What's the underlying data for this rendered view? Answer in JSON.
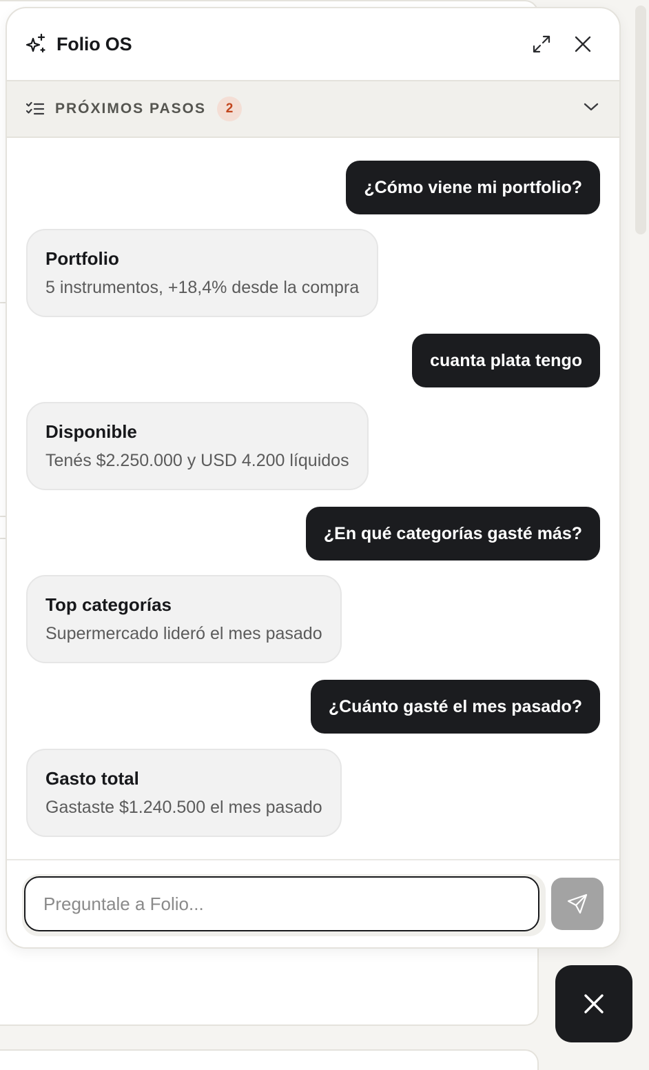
{
  "chat": {
    "title": "Folio OS",
    "header_icons": {
      "logo": "sparkle-icon",
      "expand": "expand-icon",
      "close": "close-icon"
    },
    "next_steps": {
      "label": "PRÓXIMOS PASOS",
      "count": "2",
      "icon": "checklist-icon",
      "toggle_icon": "chevron-down-icon"
    },
    "messages": [
      {
        "role": "user",
        "text": "¿Cómo viene mi portfolio?"
      },
      {
        "role": "assistant",
        "title": "Portfolio",
        "text": "5 instrumentos, +18,4% desde la compra"
      },
      {
        "role": "user",
        "text": "cuanta plata tengo"
      },
      {
        "role": "assistant",
        "title": "Disponible",
        "text": "Tenés $2.250.000 y USD 4.200 líquidos"
      },
      {
        "role": "user",
        "text": "¿En qué categorías gasté más?"
      },
      {
        "role": "assistant",
        "title": "Top categorías",
        "text": "Supermercado lideró el mes pasado"
      },
      {
        "role": "user",
        "text": "¿Cuánto gasté el mes pasado?"
      },
      {
        "role": "assistant",
        "title": "Gasto total",
        "text": "Gastaste $1.240.500 el mes pasado"
      }
    ],
    "input": {
      "placeholder": "Preguntale a Folio...",
      "value": ""
    },
    "send_icon": "send-icon"
  },
  "fab": {
    "icon": "close-icon"
  },
  "colors": {
    "bubble_user": "#1b1c1f",
    "badge_bg": "#f4ded5",
    "badge_text": "#c2461e",
    "send_disabled": "#a3a3a3"
  }
}
